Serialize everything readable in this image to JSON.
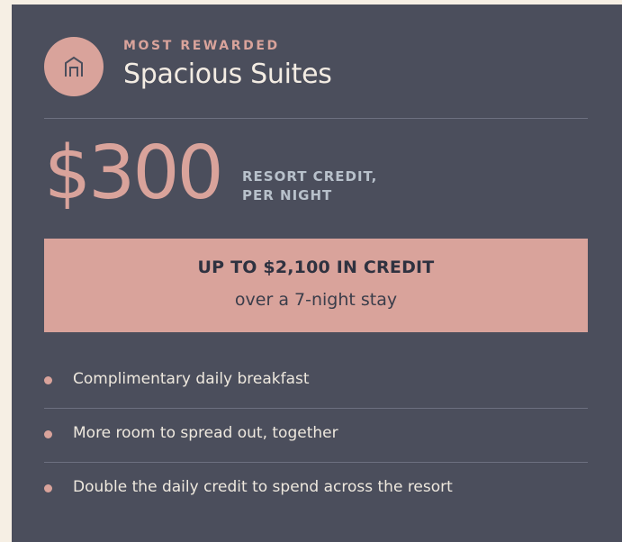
{
  "card": {
    "eyebrow": "MOST REWARDED",
    "title": "Spacious Suites",
    "icon": "house-icon",
    "price": "$300",
    "price_note_line1": "RESORT CREDIT,",
    "price_note_line2": "PER NIGHT",
    "credit_headline": "UP TO $2,100 IN CREDIT",
    "credit_subline": "over a 7-night stay",
    "benefits": [
      "Complimentary daily breakfast",
      "More room to spread out, together",
      "Double the daily credit to spend across the resort"
    ]
  },
  "colors": {
    "card_background": "#4b4e5c",
    "accent": "#d9a39b",
    "page_background": "#f6efe4"
  }
}
